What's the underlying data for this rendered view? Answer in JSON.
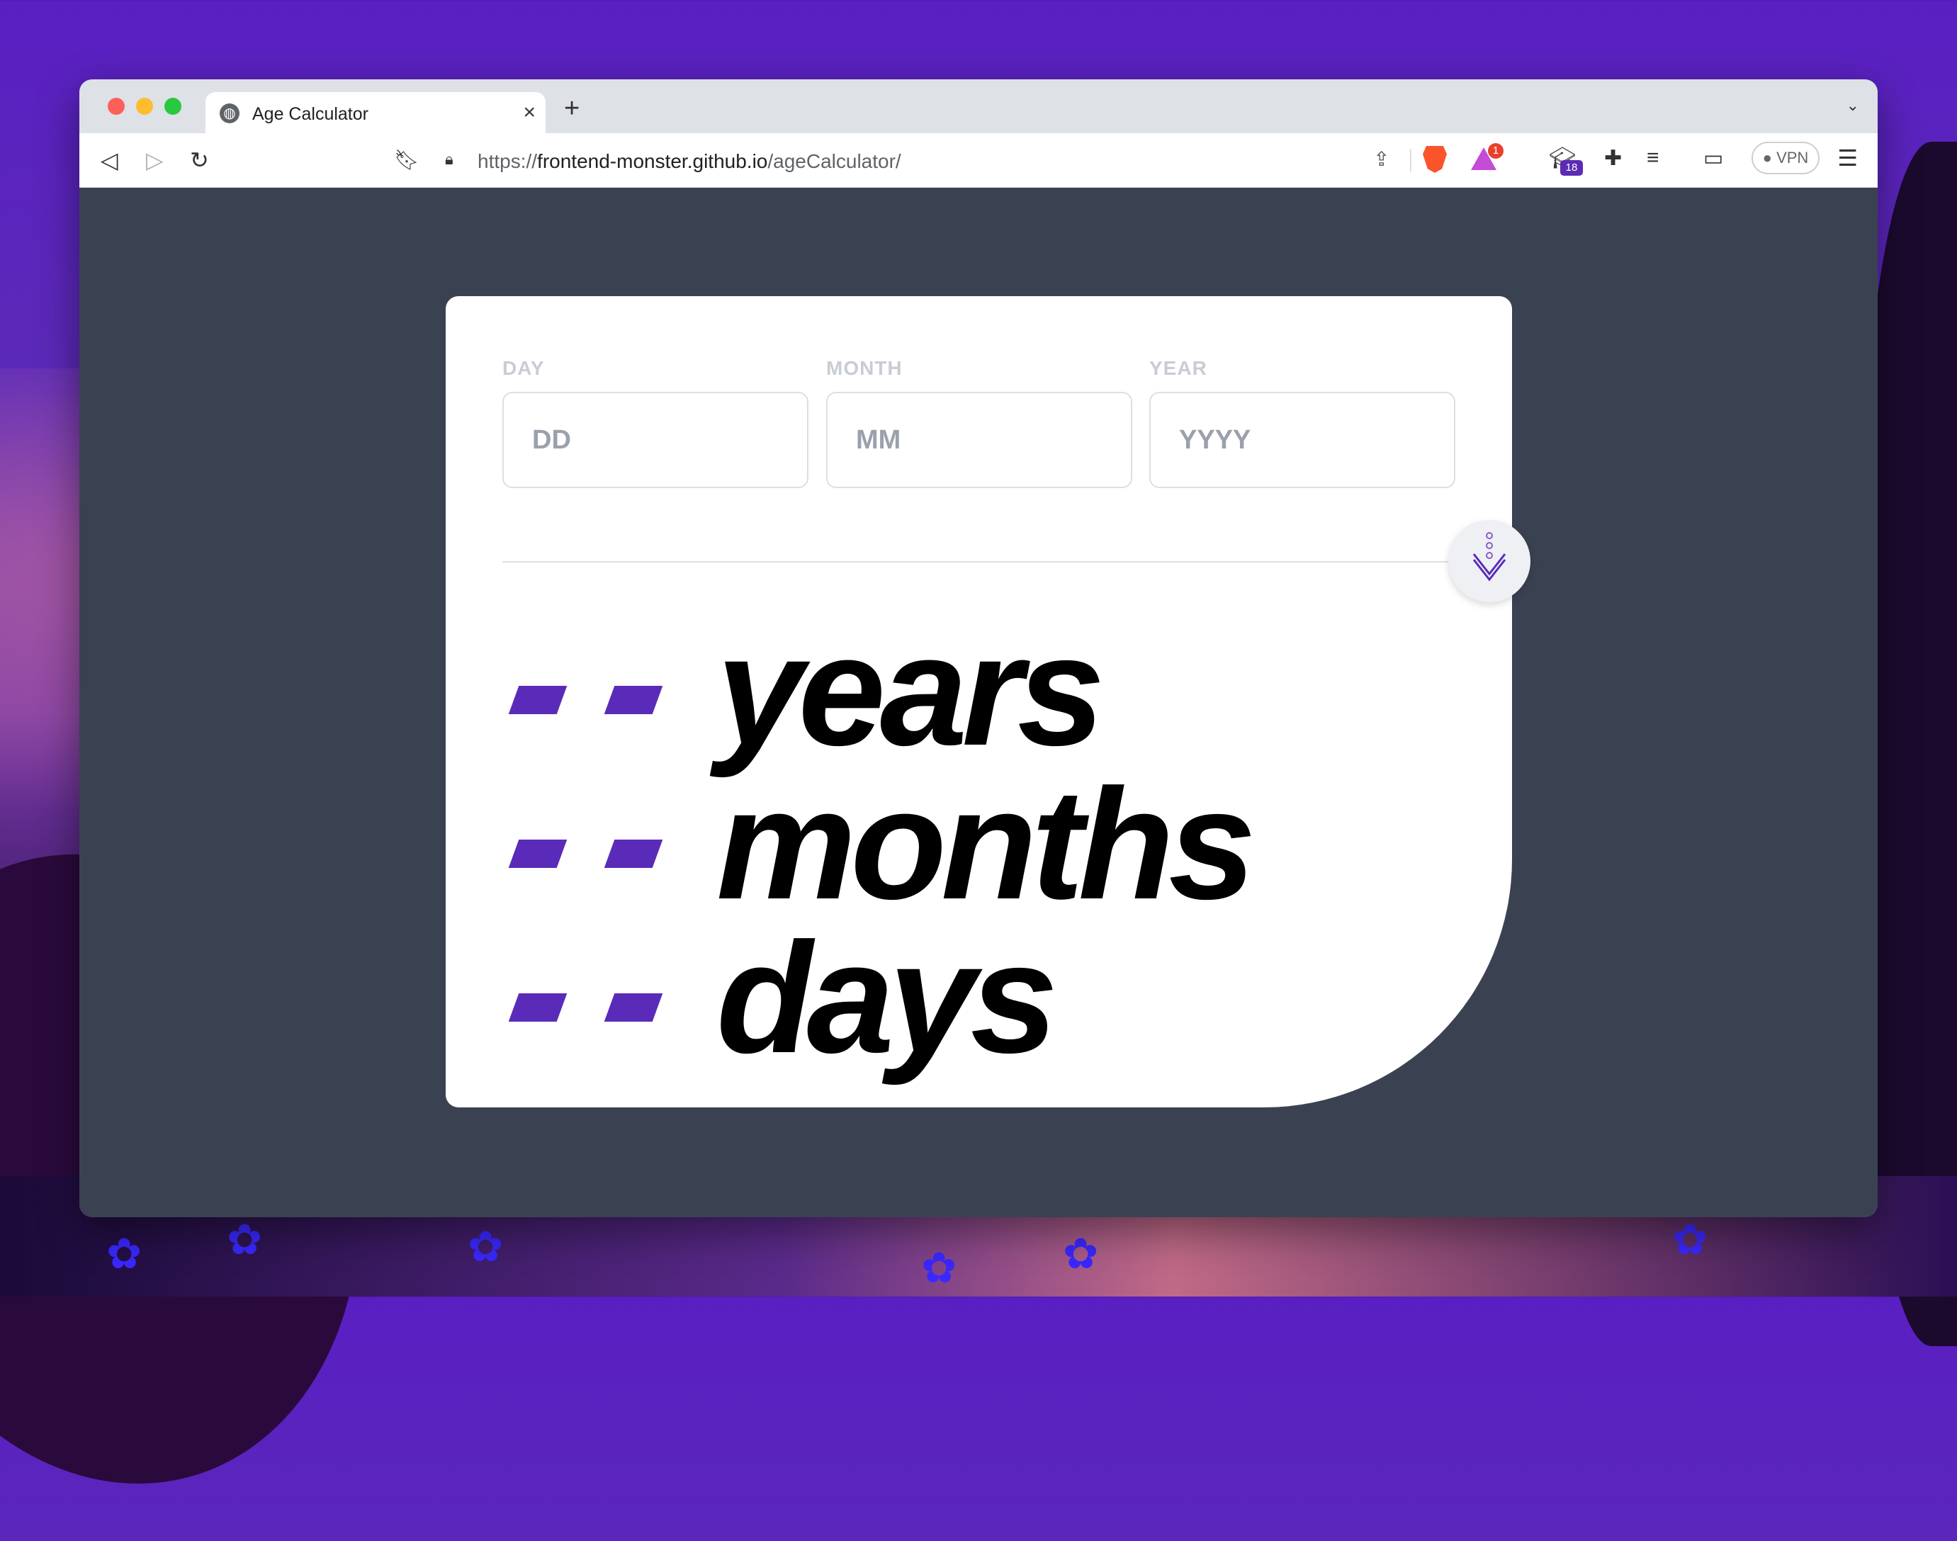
{
  "browser": {
    "tab_title": "Age Calculator",
    "url_scheme": "https://",
    "url_host": "frontend-monster.github.io",
    "url_path": "/ageCalculator/",
    "rewards_badge": "1",
    "extension_badge": "18",
    "vpn_label": "VPN"
  },
  "form": {
    "day_label": "DAY",
    "day_placeholder": "DD",
    "month_label": "MONTH",
    "month_placeholder": "MM",
    "year_label": "YEAR",
    "year_placeholder": "YYYY"
  },
  "results": [
    {
      "value": "- -",
      "unit": "years"
    },
    {
      "value": "- -",
      "unit": "months"
    },
    {
      "value": "- -",
      "unit": "days"
    }
  ],
  "colors": {
    "accent": "#5a2bb8",
    "page_bg": "#3a4252",
    "card_bg": "#ffffff",
    "label": "#c8ccd4"
  }
}
